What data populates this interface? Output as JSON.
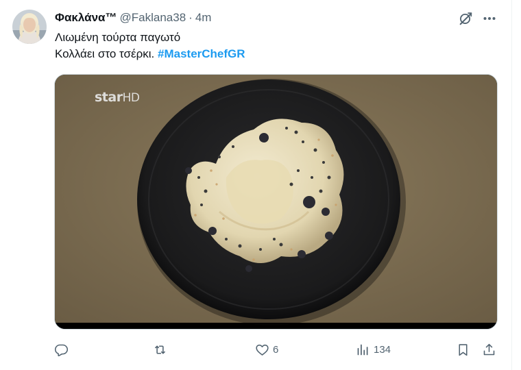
{
  "tweet": {
    "author": {
      "display_name": "Φακλάνα™",
      "handle": "@Faklana38"
    },
    "separator": "·",
    "time": "4m",
    "text_line1": "Λιωμένη τούρτα παγωτό",
    "text_line2_prefix": "Κολλάει στο τσέρκι.",
    "hashtag": "#MasterChefGR",
    "media": {
      "watermark_bold": "star",
      "watermark_light": "HD"
    },
    "metrics": {
      "replies": "",
      "retweets": "",
      "likes": "6",
      "views": "134"
    }
  },
  "icons": {
    "grok": "grok-icon",
    "more": "more-dots-icon",
    "reply": "reply-icon",
    "retweet": "retweet-icon",
    "like": "heart-icon",
    "views": "views-bar-icon",
    "bookmark": "bookmark-icon",
    "share": "share-icon"
  },
  "colors": {
    "hashtag": "#1d9bf0",
    "secondary_text": "#536471",
    "primary_text": "#0f1419"
  }
}
